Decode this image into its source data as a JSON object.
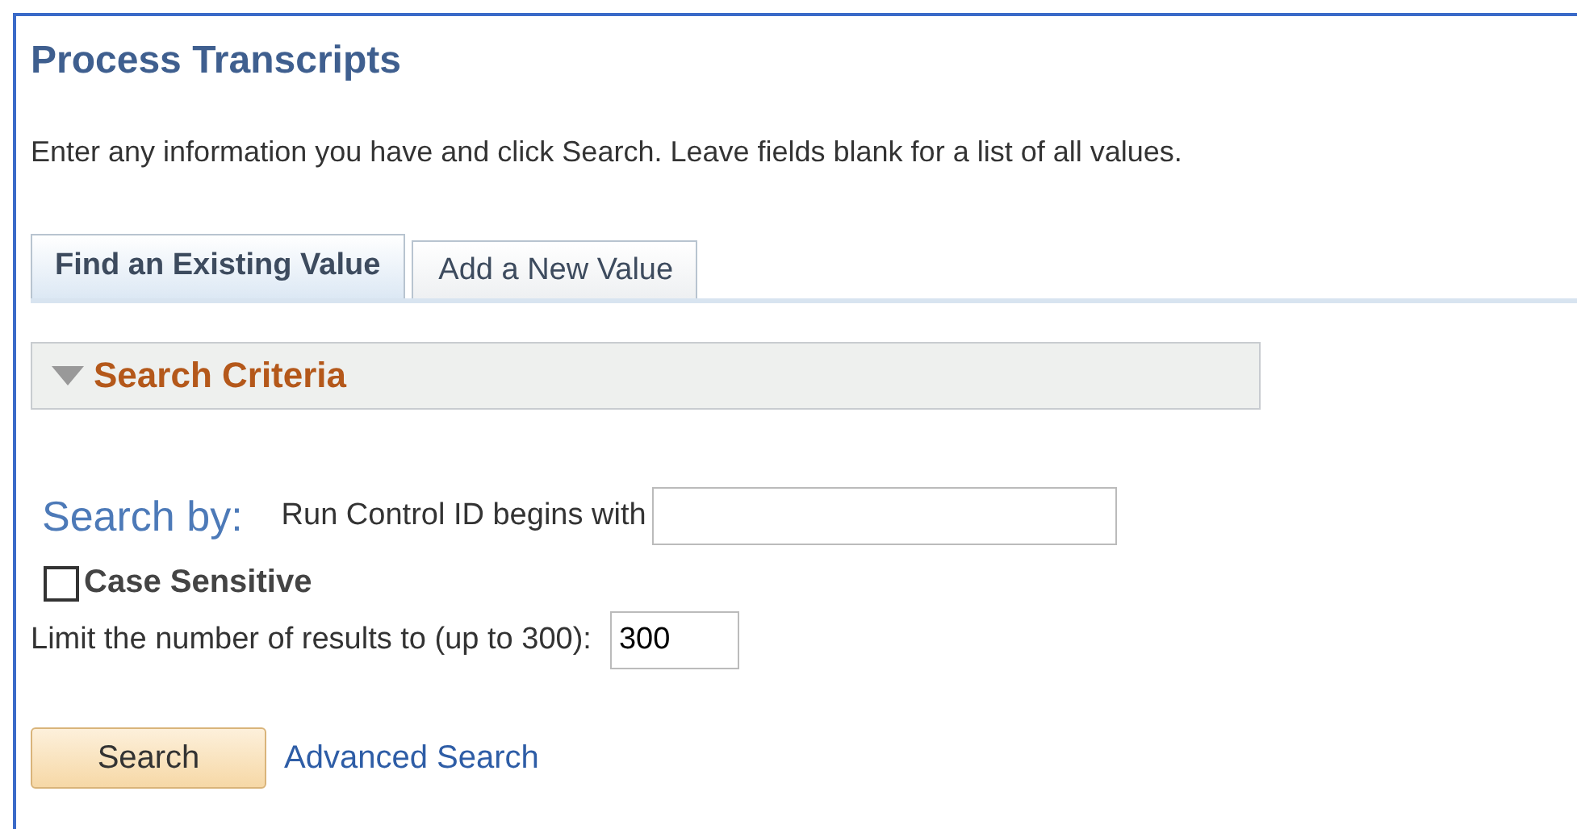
{
  "page": {
    "title": "Process Transcripts",
    "instructions": "Enter any information you have and click Search. Leave fields blank for a list of all values."
  },
  "tabs": [
    {
      "label": "Find an Existing Value",
      "selected": true
    },
    {
      "label": "Add a New Value",
      "selected": false
    }
  ],
  "section": {
    "title": "Search Criteria",
    "expanded": true
  },
  "search_by": {
    "label": "Search by:",
    "field_label": "Run Control ID begins with"
  },
  "case_sensitive": {
    "label": "Case Sensitive",
    "checked": false
  },
  "limit": {
    "label": "Limit the number of results to (up to 300):",
    "value": "300"
  },
  "buttons": {
    "search": "Search",
    "advanced": "Advanced Search"
  }
}
